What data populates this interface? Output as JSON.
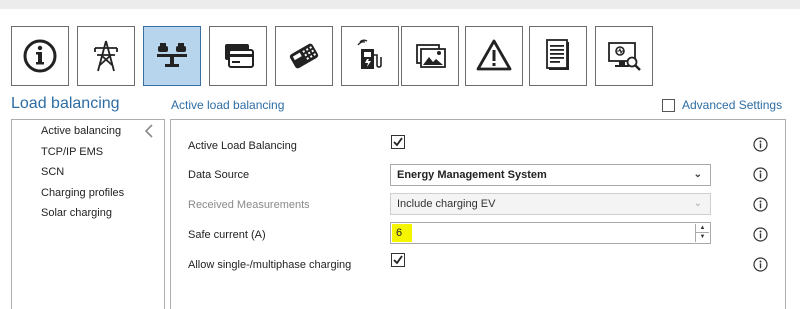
{
  "toolbar": {
    "buttons": [
      {
        "name": "info-tab-button",
        "icon": "info-icon",
        "active": false
      },
      {
        "name": "grid-tab-button",
        "icon": "power-pylon-icon",
        "active": false
      },
      {
        "name": "load-balancing-tab-button",
        "icon": "balance-scale-icon",
        "active": true
      },
      {
        "name": "payment-tab-button",
        "icon": "credit-card-icon",
        "active": false
      },
      {
        "name": "card-reader-tab-button",
        "icon": "card-terminal-icon",
        "active": false
      },
      {
        "name": "charging-station-tab-button",
        "icon": "charging-station-icon",
        "active": false
      },
      {
        "name": "display-tab-button",
        "icon": "image-icon",
        "active": false
      },
      {
        "name": "warnings-tab-button",
        "icon": "warning-icon",
        "active": false
      },
      {
        "name": "log-tab-button",
        "icon": "document-icon",
        "active": false
      },
      {
        "name": "diagnostics-tab-button",
        "icon": "monitor-search-icon",
        "active": false
      }
    ]
  },
  "page": {
    "title": "Load balancing",
    "section_title": "Active load balancing",
    "advanced_settings_label": "Advanced Settings"
  },
  "sidebar": {
    "items": [
      {
        "label": "Active balancing",
        "selected": true
      },
      {
        "label": "TCP/IP EMS",
        "selected": false
      },
      {
        "label": "SCN",
        "selected": false
      },
      {
        "label": "Charging profiles",
        "selected": false
      },
      {
        "label": "Solar charging",
        "selected": false
      }
    ]
  },
  "form": {
    "active_load_balancing_label": "Active Load Balancing",
    "active_load_balancing_checked": true,
    "data_source_label": "Data Source",
    "data_source_value": "Energy Management System",
    "received_measurements_label": "Received Measurements",
    "received_measurements_value": "Include charging EV",
    "safe_current_label": "Safe current (A)",
    "safe_current_value": "6",
    "allow_phase_label": "Allow single-/multiphase charging",
    "allow_phase_checked": true
  },
  "colors": {
    "accent": "#2e6da4",
    "active_tab_bg": "#b8d5ee",
    "highlight": "#f5f500"
  }
}
